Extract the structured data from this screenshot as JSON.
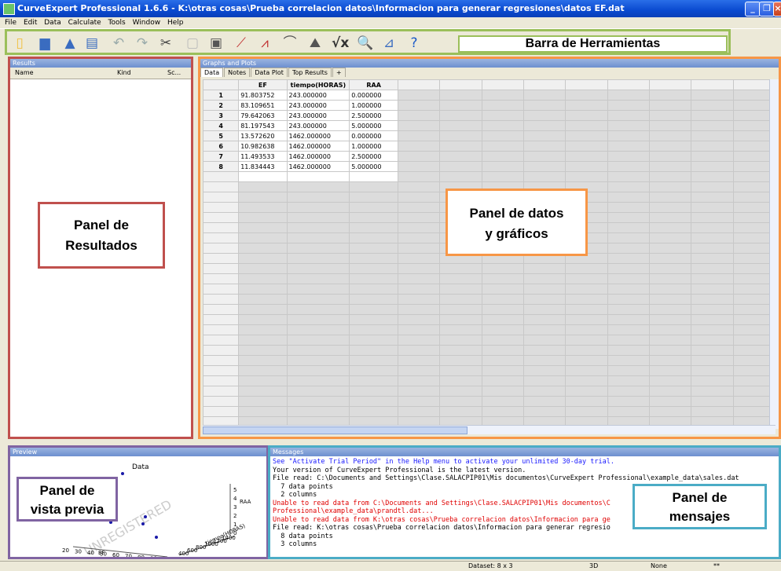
{
  "window": {
    "title": "CurveExpert Professional 1.6.6 - K:\\otras cosas\\Prueba correlacion datos\\Informacion para generar regresiones\\datos EF.dat"
  },
  "menu": [
    "File",
    "Edit",
    "Data",
    "Calculate",
    "Tools",
    "Window",
    "Help"
  ],
  "toolbar": {
    "icons": [
      "new-file-icon",
      "open-icon",
      "save-icon",
      "print-icon",
      "undo-icon",
      "redo-icon",
      "cut-icon",
      "copy-icon",
      "paste-icon",
      "linear-regression-icon",
      "nonlinear-regression-icon",
      "interpolation-icon",
      "custom-regression-icon",
      "formula-icon",
      "search-icon",
      "graph-icon",
      "help-icon"
    ],
    "callout": "Barra de Herramientas"
  },
  "results": {
    "header": "Results",
    "columns": [
      "Name",
      "Kind",
      "Sc..."
    ],
    "callout_line1": "Panel de",
    "callout_line2": "Resultados"
  },
  "data_panel": {
    "header": "Graphs and Plots",
    "tabs": [
      "Data",
      "Notes",
      "Data Plot",
      "Top Results",
      "+"
    ],
    "columns": [
      "EF",
      "tiempo(HORAS)",
      "RAA"
    ],
    "rows": [
      [
        "1",
        "91.803752",
        "243.000000",
        "0.000000"
      ],
      [
        "2",
        "83.109651",
        "243.000000",
        "1.000000"
      ],
      [
        "3",
        "79.642063",
        "243.000000",
        "2.500000"
      ],
      [
        "4",
        "81.197543",
        "243.000000",
        "5.000000"
      ],
      [
        "5",
        "13.572620",
        "1462.000000",
        "0.000000"
      ],
      [
        "6",
        "10.982638",
        "1462.000000",
        "1.000000"
      ],
      [
        "7",
        "11.493533",
        "1462.000000",
        "2.500000"
      ],
      [
        "8",
        "11.834443",
        "1462.000000",
        "5.000000"
      ]
    ],
    "callout_line1": "Panel de datos",
    "callout_line2": "y gráficos"
  },
  "preview": {
    "header": "Preview",
    "plot_title": "Data",
    "axis_label": "RAA",
    "z_ticks": [
      "5",
      "4",
      "3",
      "2",
      "1",
      "0"
    ],
    "x_ticks": [
      "20",
      "30",
      "40",
      "50",
      "60",
      "70",
      "80",
      "90"
    ],
    "y_ticks": [
      "400",
      "600",
      "800",
      "1000",
      "1200",
      "1400"
    ],
    "x_label": "EF",
    "y_label": "tiempo(HORAS)",
    "watermark": "UNREGISTERED",
    "callout_line1": "Panel de",
    "callout_line2": "vista previa"
  },
  "messages": {
    "header": "Messages",
    "lines": [
      {
        "text": "See \"Activate Trial Period\" in the Help menu to activate your unlimited 30-day trial.",
        "color": "#1a1aff"
      },
      {
        "text": "Your version of CurveExpert Professional is the latest version.",
        "color": "#000000"
      },
      {
        "text": "File read: C:\\Documents and Settings\\Clase.SALACPIP01\\Mis documentos\\CurveExpert Professional\\example_data\\sales.dat",
        "color": "#000000"
      },
      {
        "text": "  7 data points",
        "color": "#000000"
      },
      {
        "text": "  2 columns",
        "color": "#000000"
      },
      {
        "text": "Unable to read data from C:\\Documents and Settings\\Clase.SALACPIP01\\Mis documentos\\C",
        "color": "#e00000"
      },
      {
        "text": "Professional\\example_data\\prandtl.dat...",
        "color": "#e00000"
      },
      {
        "text": "Unable to read data from K:\\otras cosas\\Prueba correlacion datos\\Informacion para ge",
        "color": "#e00000"
      },
      {
        "text": "File read: K:\\otras cosas\\Prueba correlacion datos\\Informacion para generar regresio",
        "color": "#000000"
      },
      {
        "text": "  8 data points",
        "color": "#000000"
      },
      {
        "text": "  3 columns",
        "color": "#000000"
      }
    ],
    "callout_line1": "Panel de",
    "callout_line2": "mensajes"
  },
  "statusbar": {
    "dataset": "Dataset: 8 x 3",
    "mode": "3D",
    "fit": "None",
    "extra": "**"
  }
}
